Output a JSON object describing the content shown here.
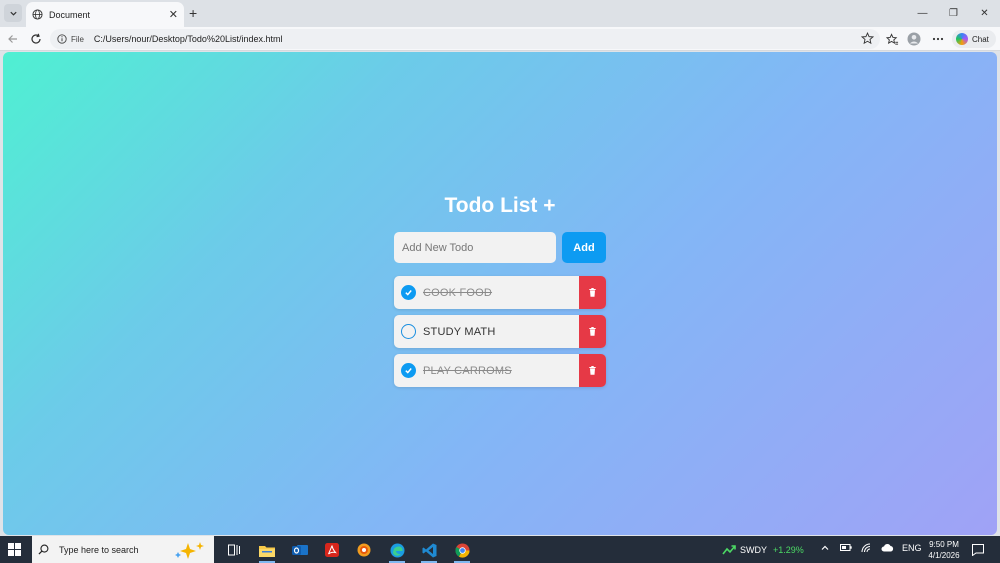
{
  "browser": {
    "tab_title": "Document",
    "tab_close": "✕",
    "new_tab": "+",
    "omnibox_scheme_label": "File",
    "url": "C:/Users/nour/Desktop/Todo%20List/index.html",
    "chat_label": "Chat",
    "win_min": "—",
    "win_restore": "❐",
    "win_close": "✕"
  },
  "app": {
    "title": "Todo List +",
    "input_placeholder": "Add New Todo",
    "add_button": "Add",
    "todos": [
      {
        "text": "COOK FOOD",
        "done": true
      },
      {
        "text": "STUDY MATH",
        "done": false
      },
      {
        "text": "PLAY CARROMS",
        "done": true
      }
    ],
    "colors": {
      "accent": "#0d9bf2",
      "delete": "#e63946"
    }
  },
  "taskbar": {
    "search_placeholder": "Type here to search",
    "stock_symbol": "SWDY",
    "stock_change": "+1.29%",
    "lang": "ENG",
    "time": "9:50 PM",
    "date": "4/1/2026"
  }
}
